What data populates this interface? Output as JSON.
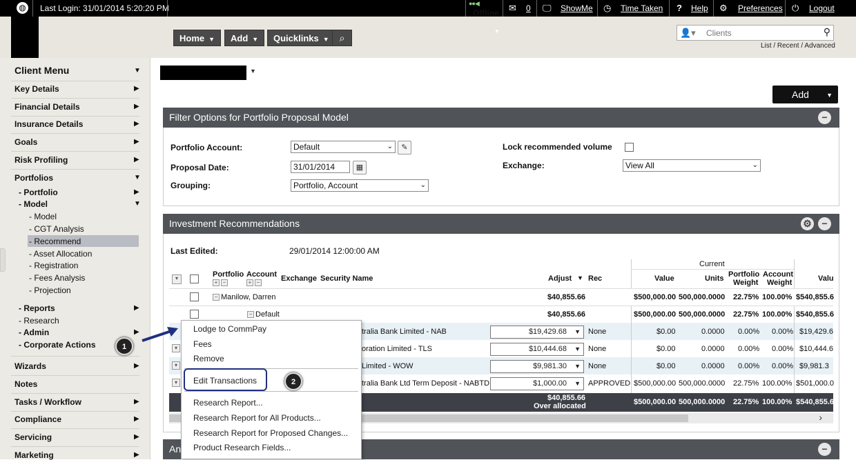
{
  "topbar": {
    "last_login": "Last Login: 31/01/2014 5:20:20 PM",
    "offline": "Offline",
    "mail_count": "0",
    "showme": "ShowMe",
    "time_taken": "Time Taken",
    "help": "Help",
    "help_icon": "?",
    "preferences": "Preferences",
    "logout": "Logout"
  },
  "nav": {
    "home": "Home",
    "add": "Add",
    "quicklinks": "Quicklinks",
    "clients_placeholder": "Clients",
    "list_links": "List / Recent / Advanced"
  },
  "sidebar": {
    "client_menu": "Client Menu",
    "key_details": "Key Details",
    "financial_details": "Financial Details",
    "insurance_details": "Insurance Details",
    "goals": "Goals",
    "risk_profiling": "Risk Profiling",
    "portfolios": "Portfolios",
    "portfolio": "- Portfolio",
    "model": "- Model",
    "model_items": [
      "- Model",
      "- CGT Analysis",
      "- Recommend",
      "- Asset Allocation",
      "- Registration",
      "- Fees Analysis",
      "- Projection"
    ],
    "reports": "- Reports",
    "research": "- Research",
    "admin": "- Admin",
    "corporate_actions": "- Corporate Actions",
    "wizards": "Wizards",
    "notes": "Notes",
    "tasks": "Tasks / Workflow",
    "compliance": "Compliance",
    "servicing": "Servicing",
    "marketing": "Marketing"
  },
  "main": {
    "add_button": "Add",
    "filter": {
      "title": "Filter Options for Portfolio Proposal Model",
      "portfolio_account_label": "Portfolio Account:",
      "portfolio_account_value": "Default",
      "proposal_date_label": "Proposal Date:",
      "proposal_date_value": "31/01/2014",
      "grouping_label": "Grouping:",
      "grouping_value": "Portfolio, Account",
      "lock_label": "Lock recommended volume",
      "exchange_label": "Exchange:",
      "exchange_value": "View All"
    },
    "recs": {
      "title": "Investment Recommendations",
      "last_edited_label": "Last Edited:",
      "last_edited_value": "29/01/2014 12:00:00 AM",
      "current_header": "Current",
      "columns": {
        "portfolio": "Portfolio",
        "account": "Account",
        "exchange": "Exchange",
        "security": "Security Name",
        "adjust": "Adjust",
        "rec": "Rec",
        "value": "Value",
        "units": "Units",
        "pw1": "Portfolio",
        "pw2": "Weight",
        "aw1": "Account",
        "aw2": "Weight",
        "valu": "Valu"
      },
      "group_row": {
        "name": "Manilow, Darren",
        "adjust": "$40,855.66",
        "value": "$500,000.00",
        "units": "500,000.0000",
        "pw": "22.75%",
        "aw": "100.00%",
        "next": "$540,855.6"
      },
      "default_row": {
        "name": "Default",
        "adjust": "$40,855.66",
        "value": "$500,000.00",
        "units": "500,000.0000",
        "pw": "22.75%",
        "aw": "100.00%",
        "next": "$540,855.6"
      },
      "rows": [
        {
          "security": "tralia Bank Limited - NAB",
          "adjust": "$19,429.68",
          "rec": "None",
          "value": "$0.00",
          "units": "0.0000",
          "pw": "0.00%",
          "aw": "0.00%",
          "next": "$19,429.6"
        },
        {
          "security": "oration Limited - TLS",
          "adjust": "$10,444.68",
          "rec": "None",
          "value": "$0.00",
          "units": "0.0000",
          "pw": "0.00%",
          "aw": "0.00%",
          "next": "$10,444.6"
        },
        {
          "security": "Limited - WOW",
          "adjust": "$9,981.30",
          "rec": "None",
          "value": "$0.00",
          "units": "0.0000",
          "pw": "0.00%",
          "aw": "0.00%",
          "next": "$9,981.3"
        },
        {
          "security": "tralia Bank Ltd Term Deposit - NABTD",
          "adjust": "$1,000.00",
          "rec": "APPROVED",
          "value": "$500,000.00",
          "units": "500,000.0000",
          "pw": "22.75%",
          "aw": "100.00%",
          "next": "$501,000.0"
        }
      ],
      "total": {
        "adjust": "$40,855.66",
        "note": "Over allocated",
        "value": "$500,000.00",
        "units": "500,000.0000",
        "pw": "22.75%",
        "aw": "100.00%",
        "next": "$540,855.6"
      }
    },
    "third_panel_title": "An"
  },
  "context_menu": {
    "items_top": [
      "Lodge to CommPay",
      "Fees",
      "Remove"
    ],
    "edit": "Edit Transactions",
    "items_bottom": [
      "Research Report...",
      "Research Report for All Products...",
      "Research Report for Proposed Changes...",
      "Product Research Fields..."
    ]
  },
  "callouts": [
    "1",
    "2"
  ]
}
